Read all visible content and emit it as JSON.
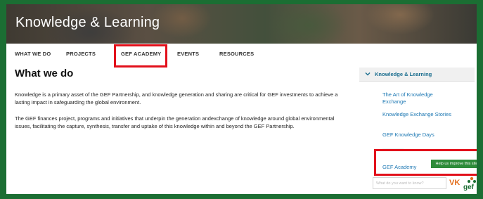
{
  "header": {
    "title": "Knowledge & Learning"
  },
  "nav": {
    "items": [
      {
        "label": "WHAT WE DO"
      },
      {
        "label": "PROJECTS"
      },
      {
        "label": "GEF ACADEMY"
      },
      {
        "label": "EVENTS"
      },
      {
        "label": "RESOURCES"
      }
    ]
  },
  "main": {
    "title": "What we do",
    "paragraphs": [
      "Knowledge is a primary asset of the GEF Partnership, and knowledge generation and sharing are critical for GEF investments to achieve a lasting impact in safeguarding the global environment.",
      "The GEF finances project, programs and initiatives that underpin the generation andexchange of knowledge around global environmental issues, facilitating the capture, synthesis, transfer and uptake of this knowledge within and beyond the GEF Partnership."
    ]
  },
  "sidebar": {
    "header_label": "Knowledge & Learning",
    "links": [
      {
        "label": "The Art of Knowledge Exchange"
      },
      {
        "label": "Knowledge Exchange Stories"
      },
      {
        "label": "GEF Knowledge Days"
      },
      {
        "label": "GEF Academy"
      }
    ],
    "help_button": "Help us improve this site"
  },
  "search": {
    "placeholder": "What do you want to know?"
  },
  "logo": {
    "text": "gef",
    "arrow": "VK",
    "colors": {
      "green": "#1b6e33",
      "orange": "#e36f1e"
    }
  },
  "highlight_color": "#e2101b",
  "frame_color": "#1b6e33"
}
